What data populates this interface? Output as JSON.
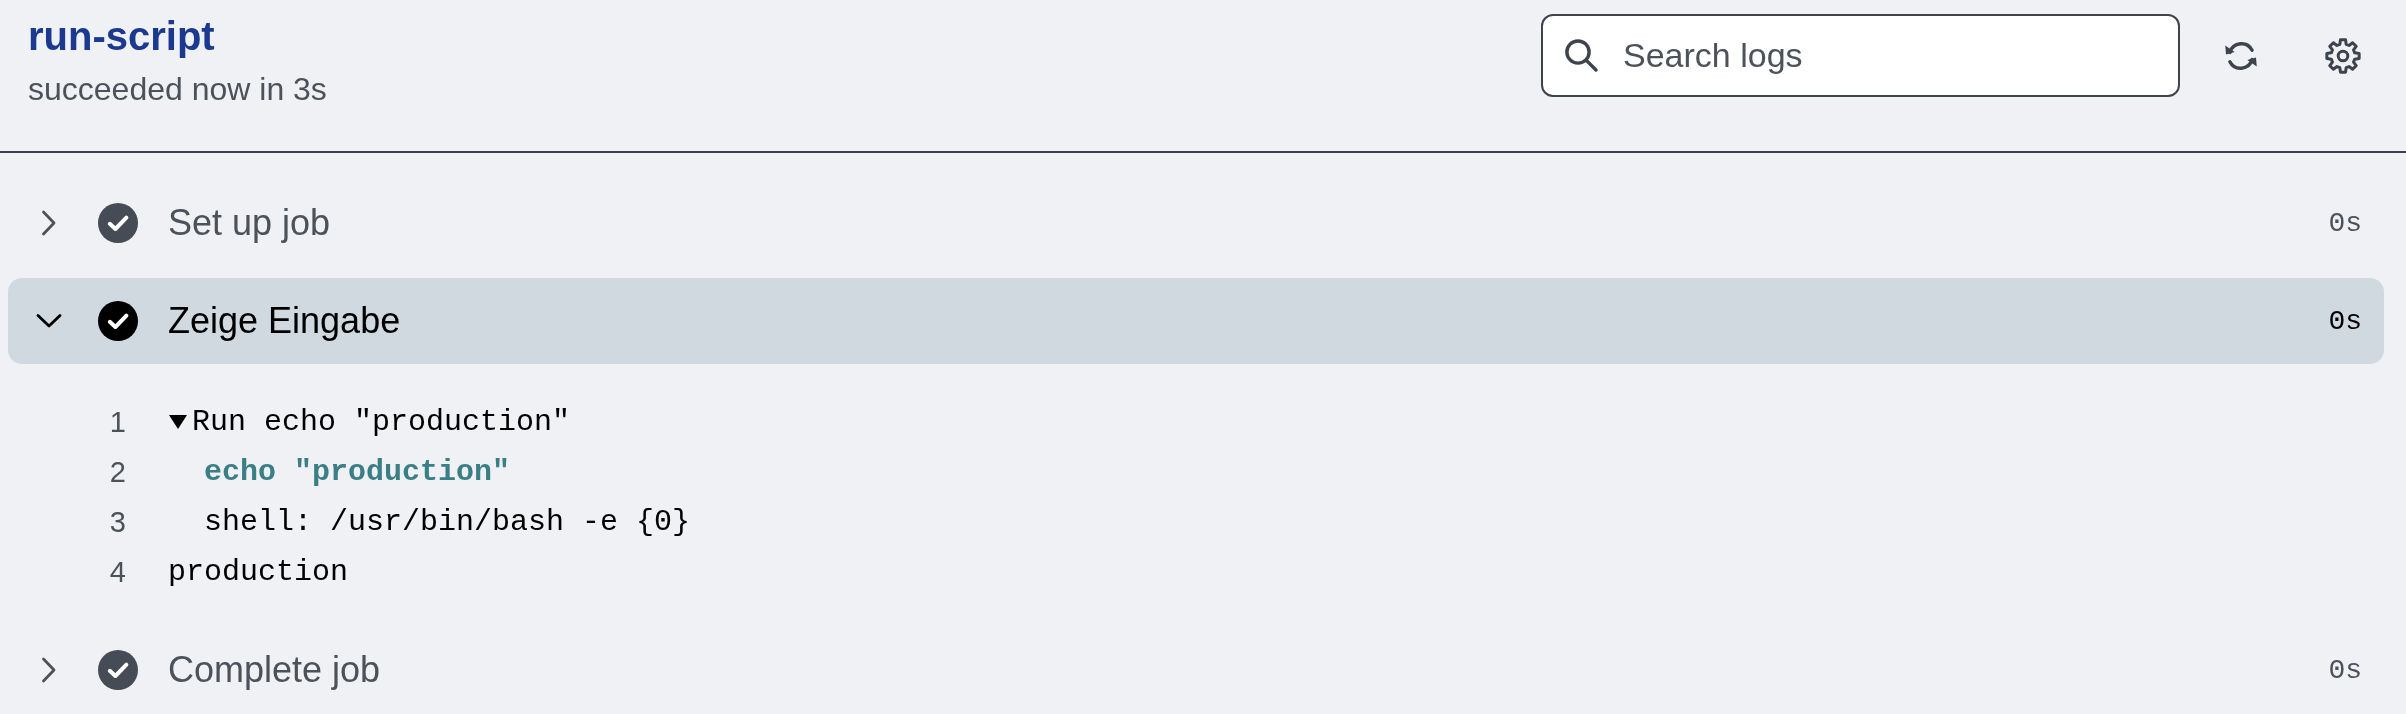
{
  "job": {
    "title": "run-script",
    "status": "succeeded now in 3s"
  },
  "toolbar": {
    "search": {
      "placeholder": "Search logs"
    }
  },
  "steps": [
    {
      "name": "Set up job",
      "succeeded": true,
      "expanded": false,
      "selected": false,
      "duration": "0s"
    },
    {
      "name": "Zeige Eingabe",
      "succeeded": true,
      "expanded": true,
      "selected": true,
      "duration": "0s",
      "log": [
        {
          "number": "1",
          "kind": "group",
          "expanded": true,
          "text": "Run echo \"production\"",
          "children": [
            {
              "number": "2",
              "kind": "command",
              "text": "echo \"production\""
            },
            {
              "number": "3",
              "kind": "info",
              "text": "shell: /usr/bin/bash -e {0}"
            }
          ]
        },
        {
          "number": "4",
          "kind": "output",
          "text": "production"
        }
      ]
    },
    {
      "name": "Complete job",
      "succeeded": true,
      "expanded": false,
      "selected": false,
      "duration": "0s"
    }
  ]
}
